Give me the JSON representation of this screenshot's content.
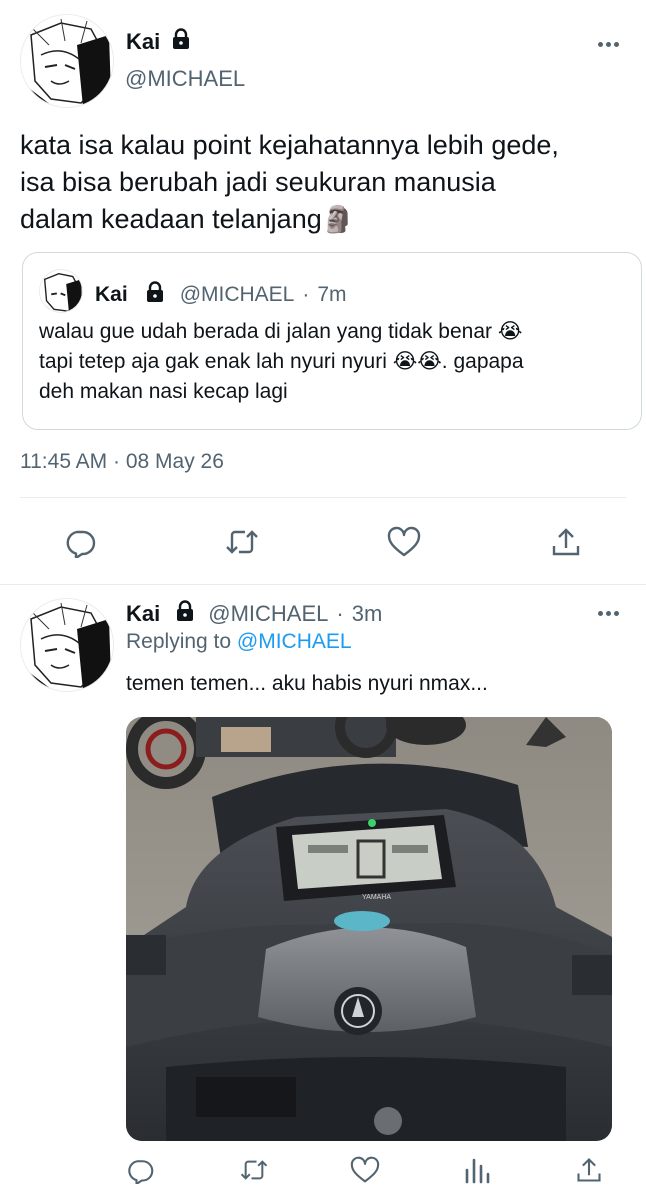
{
  "main_tweet": {
    "display_name": "Kai",
    "handle": "@MICHAEL",
    "text_lines": [
      "kata isa kalau point kejahatannya lebih gede,",
      "isa bisa berubah jadi seukuran manusia",
      "dalam keadaan telanjang"
    ],
    "emoji_end": "🗿",
    "quoted": {
      "display_name": "Kai",
      "handle": "@MICHAEL",
      "separator": "·",
      "time": "7m",
      "line1": "walau gue udah berada di jalan yang tidak benar 😭",
      "line2": "tapi tetep aja gak enak lah nyuri nyuri 😭😭. gapapa",
      "line3": "deh makan nasi kecap lagi"
    },
    "timestamp": "11:45 AM · 08 May 26"
  },
  "reply_tweet": {
    "display_name": "Kai",
    "handle": "@MICHAEL",
    "separator": "·",
    "time": "3m",
    "replying_prefix": "Replying to",
    "replying_to": "@MICHAEL",
    "text": "temen temen... aku habis nyuri nmax...",
    "image_alt": "Yamaha NMAX scooter dashboard",
    "brand_on_dash": "YAMAHA"
  },
  "icons": {
    "reply": "reply-icon",
    "retweet": "retweet-icon",
    "like": "like-icon",
    "share": "share-icon",
    "analytics": "analytics-icon",
    "more": "more-icon",
    "lock": "lock-icon"
  },
  "colors": {
    "link": "#1d9bf0",
    "muted": "#536471",
    "text": "#0f1419",
    "border": "#cfd9de"
  }
}
